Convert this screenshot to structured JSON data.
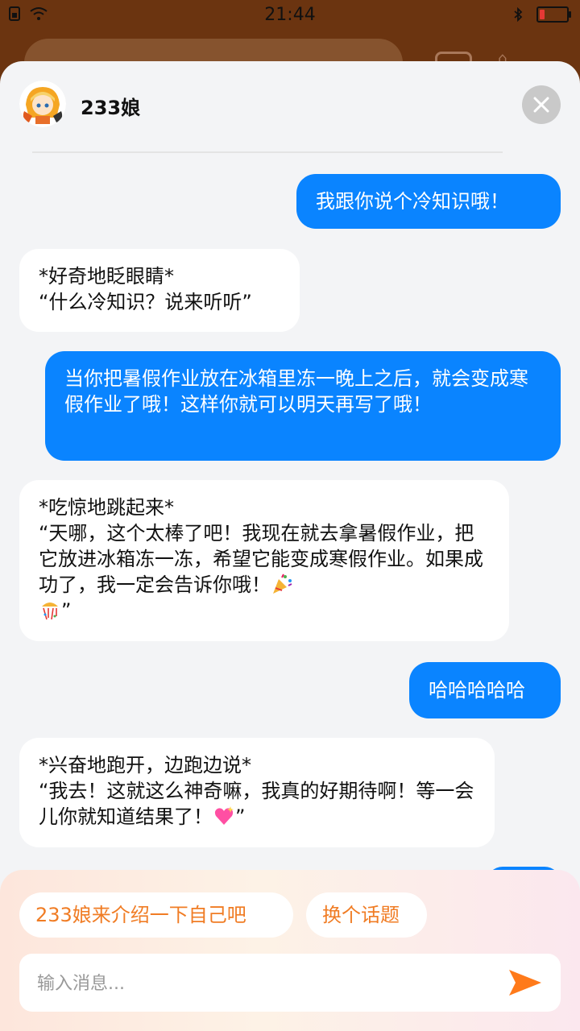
{
  "status": {
    "time": "21:44",
    "battery_level": 0.2
  },
  "chat": {
    "title": "233娘",
    "messages": [
      {
        "role": "user",
        "text": "我跟你说个冷知识哦！"
      },
      {
        "role": "bot",
        "text": "*好奇地眨眼睛*\n“什么冷知识？说来听听”"
      },
      {
        "role": "user",
        "text": "当你把暑假作业放在冰箱里冻一晚上之后，就会变成寒假作业了哦！这样你就可以明天再写了哦！"
      },
      {
        "role": "bot",
        "text": "*吃惊地跳起来*\n“天哪，这个太棒了吧！我现在就去拿暑假作业，把它放进冰箱冻一冻，希望它能变成寒假作业。如果成功了，我一定会告诉你哦！",
        "suffix": "”"
      },
      {
        "role": "user",
        "text": "哈哈哈哈哈"
      },
      {
        "role": "bot",
        "text": "*兴奋地跑开，边跑边说*\n“我去！这就这么神奇嘛，我真的好期待啊！等一会儿你就知道结果了！",
        "suffix": "”"
      }
    ]
  },
  "suggestions": [
    "233娘来介绍一下自己吧",
    "换个话题"
  ],
  "input": {
    "placeholder": "输入消息..."
  },
  "colors": {
    "user_bubble": "#0a84ff",
    "accent": "#f07c24",
    "bot_bubble": "#ffffff"
  },
  "icons": [
    "close-icon",
    "send-icon",
    "party-popper-icon",
    "confetti-ball-icon",
    "sparkling-heart-icon",
    "wifi-icon",
    "bluetooth-icon",
    "battery-icon"
  ]
}
